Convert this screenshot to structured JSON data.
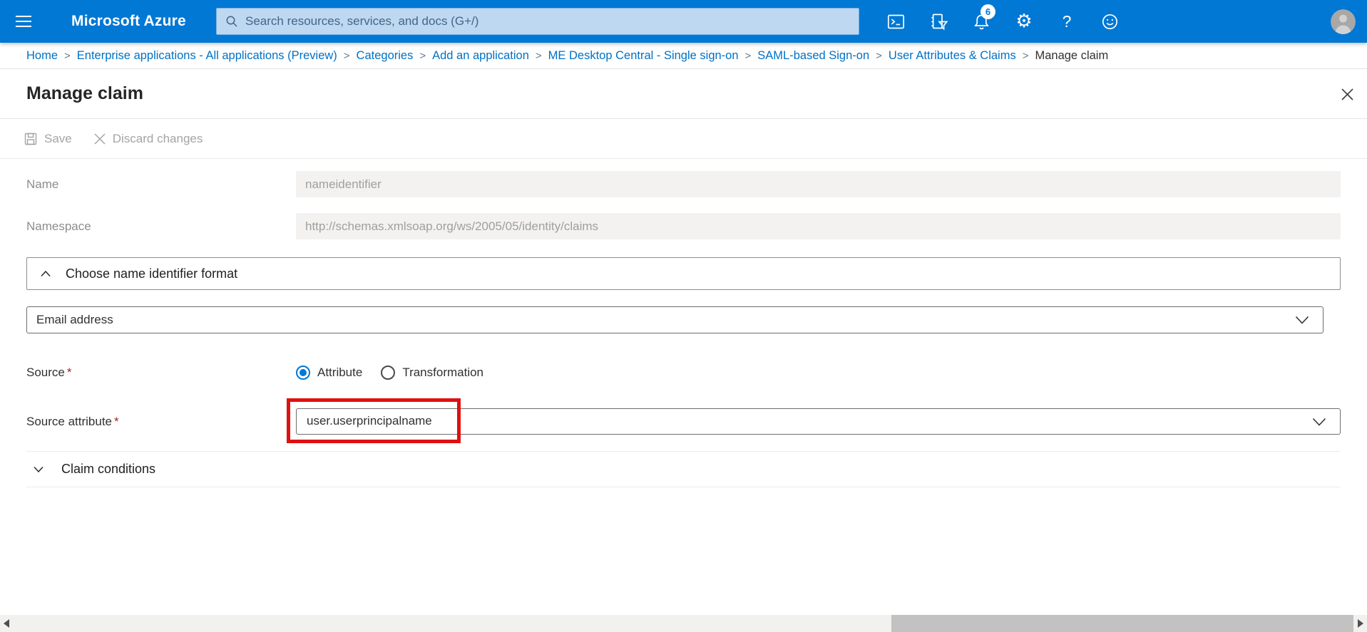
{
  "topbar": {
    "brand": "Microsoft Azure",
    "search_placeholder": "Search resources, services, and docs (G+/)",
    "notification_count": "6",
    "help_glyph": "?",
    "gear_glyph": "⚙"
  },
  "breadcrumb": {
    "separator": ">",
    "items": [
      {
        "label": "Home"
      },
      {
        "label": "Enterprise applications - All applications (Preview)"
      },
      {
        "label": "Categories"
      },
      {
        "label": "Add an application"
      },
      {
        "label": "ME Desktop Central - Single sign-on"
      },
      {
        "label": "SAML-based Sign-on"
      },
      {
        "label": "User Attributes & Claims"
      },
      {
        "label": "Manage claim"
      }
    ]
  },
  "page": {
    "title": "Manage claim"
  },
  "toolbar": {
    "save_label": "Save",
    "discard_label": "Discard changes"
  },
  "form": {
    "required_mark": "*",
    "name": {
      "label": "Name",
      "value": "nameidentifier"
    },
    "namespace": {
      "label": "Namespace",
      "value": "http://schemas.xmlsoap.org/ws/2005/05/identity/claims"
    },
    "name_identifier": {
      "header": "Choose name identifier format",
      "selected_option": "Email address"
    },
    "source": {
      "label": "Source",
      "options": [
        {
          "label": "Attribute"
        },
        {
          "label": "Transformation"
        }
      ]
    },
    "source_attribute": {
      "label": "Source attribute",
      "value": "user.userprincipalname"
    },
    "claim_conditions": {
      "header": "Claim conditions"
    }
  },
  "colors": {
    "topbar_blue": "#0078d4",
    "breadcrumb_link": "#0071c5",
    "annotation_red": "#e01010",
    "disabled_bg": "#f3f2f1",
    "required_red": "#a4262c"
  }
}
